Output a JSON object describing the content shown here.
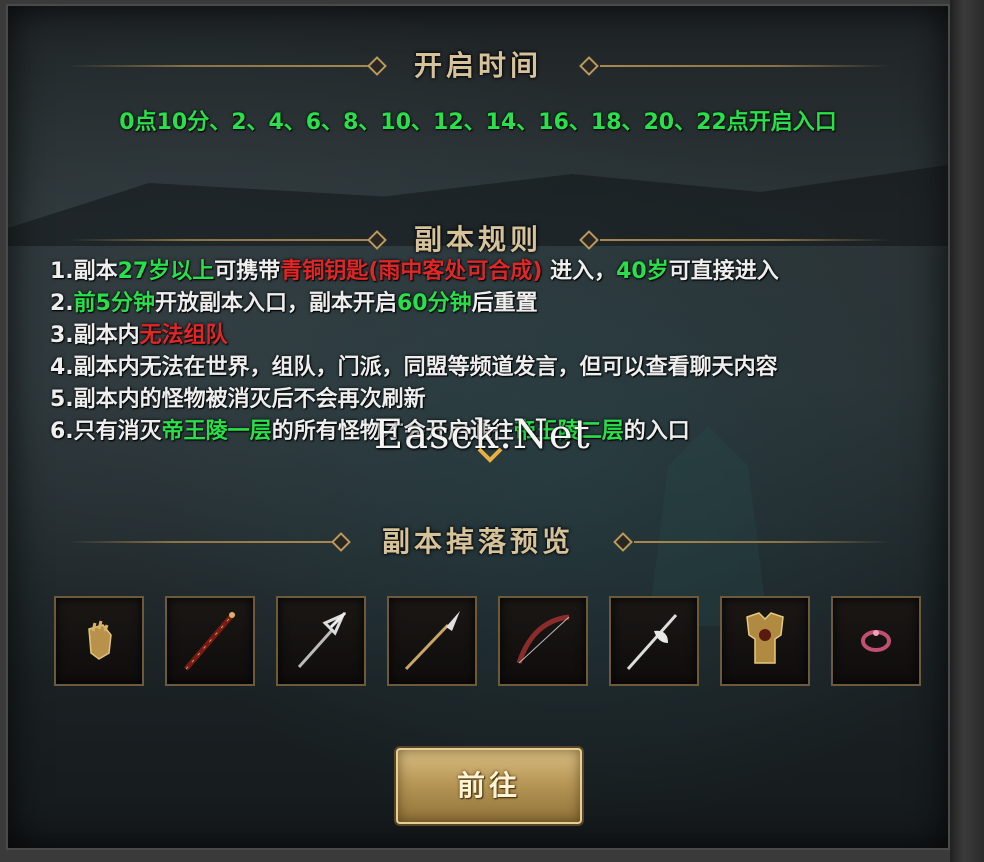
{
  "sections": {
    "open_time_title": "开启时间",
    "rules_title": "副本规则",
    "drops_title": "副本掉落预览"
  },
  "open_times": "0点10分、2、4、6、8、10、12、14、16、18、20、22点开启入口",
  "rules": {
    "r1": {
      "a": "1.副本",
      "b": "27岁以上",
      "c": "可携带",
      "d": "青铜钥匙(雨中客处可合成)",
      "e": "进入，",
      "f": "40岁",
      "g": "可直接进入"
    },
    "r2": {
      "a": "2.",
      "b": "前5分钟",
      "c": "开放副本入口，副本开启",
      "d": "60分钟",
      "e": "后重置"
    },
    "r3": {
      "a": "3.副本内",
      "b": "无法组队"
    },
    "r4": {
      "a": "4.副本内无法在世界，组队，门派，同盟等频道发言，但可以查看聊天内容"
    },
    "r5": {
      "a": "5.副本内的怪物被消灭后不会再次刷新"
    },
    "r6": {
      "a": "6.只有消灭",
      "b": "帝王陵一层",
      "c": "的所有怪物才会开启通往",
      "d": "帝王陵二层",
      "e": "的入口"
    }
  },
  "watermark": "Easck.Net",
  "drops": [
    {
      "icon": "gauntlet-icon"
    },
    {
      "icon": "staff-icon"
    },
    {
      "icon": "trident-icon"
    },
    {
      "icon": "spear-icon"
    },
    {
      "icon": "bow-icon"
    },
    {
      "icon": "halberd-icon"
    },
    {
      "icon": "armor-icon"
    },
    {
      "icon": "ring-icon"
    }
  ],
  "button": {
    "go_label": "前往"
  },
  "colors": {
    "highlight_green": "#27e04a",
    "highlight_red": "#e02626",
    "title_gold": "#d6c29a",
    "frame_gold": "#6d5a3b"
  }
}
